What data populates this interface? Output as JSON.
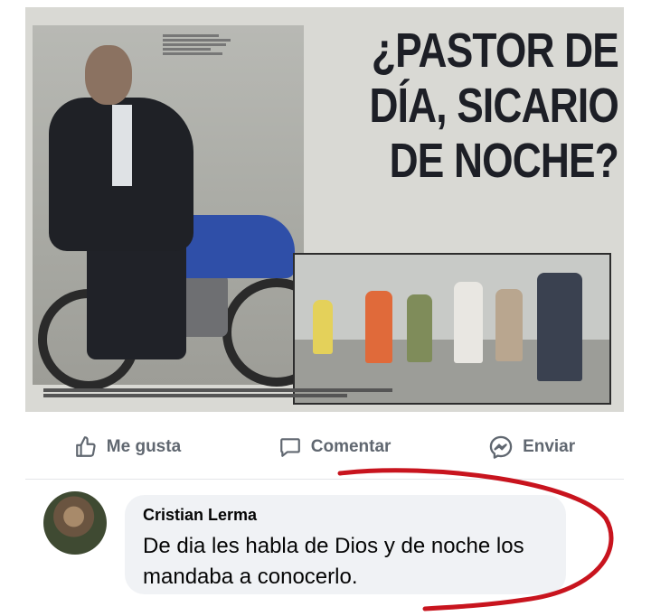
{
  "newspaper": {
    "headline_lines": [
      "¿PASTOR DE",
      "DÍA, SICARIO",
      "DE NOCHE?"
    ]
  },
  "actions": {
    "like_label": "Me gusta",
    "comment_label": "Comentar",
    "send_label": "Enviar"
  },
  "comment": {
    "author": "Cristian Lerma",
    "text": "De dia les habla de Dios y de noche los mandaba  a conocerlo."
  },
  "colors": {
    "action_text": "#606770",
    "bubble_bg": "#f0f2f5",
    "red_mark": "#c8141e"
  }
}
